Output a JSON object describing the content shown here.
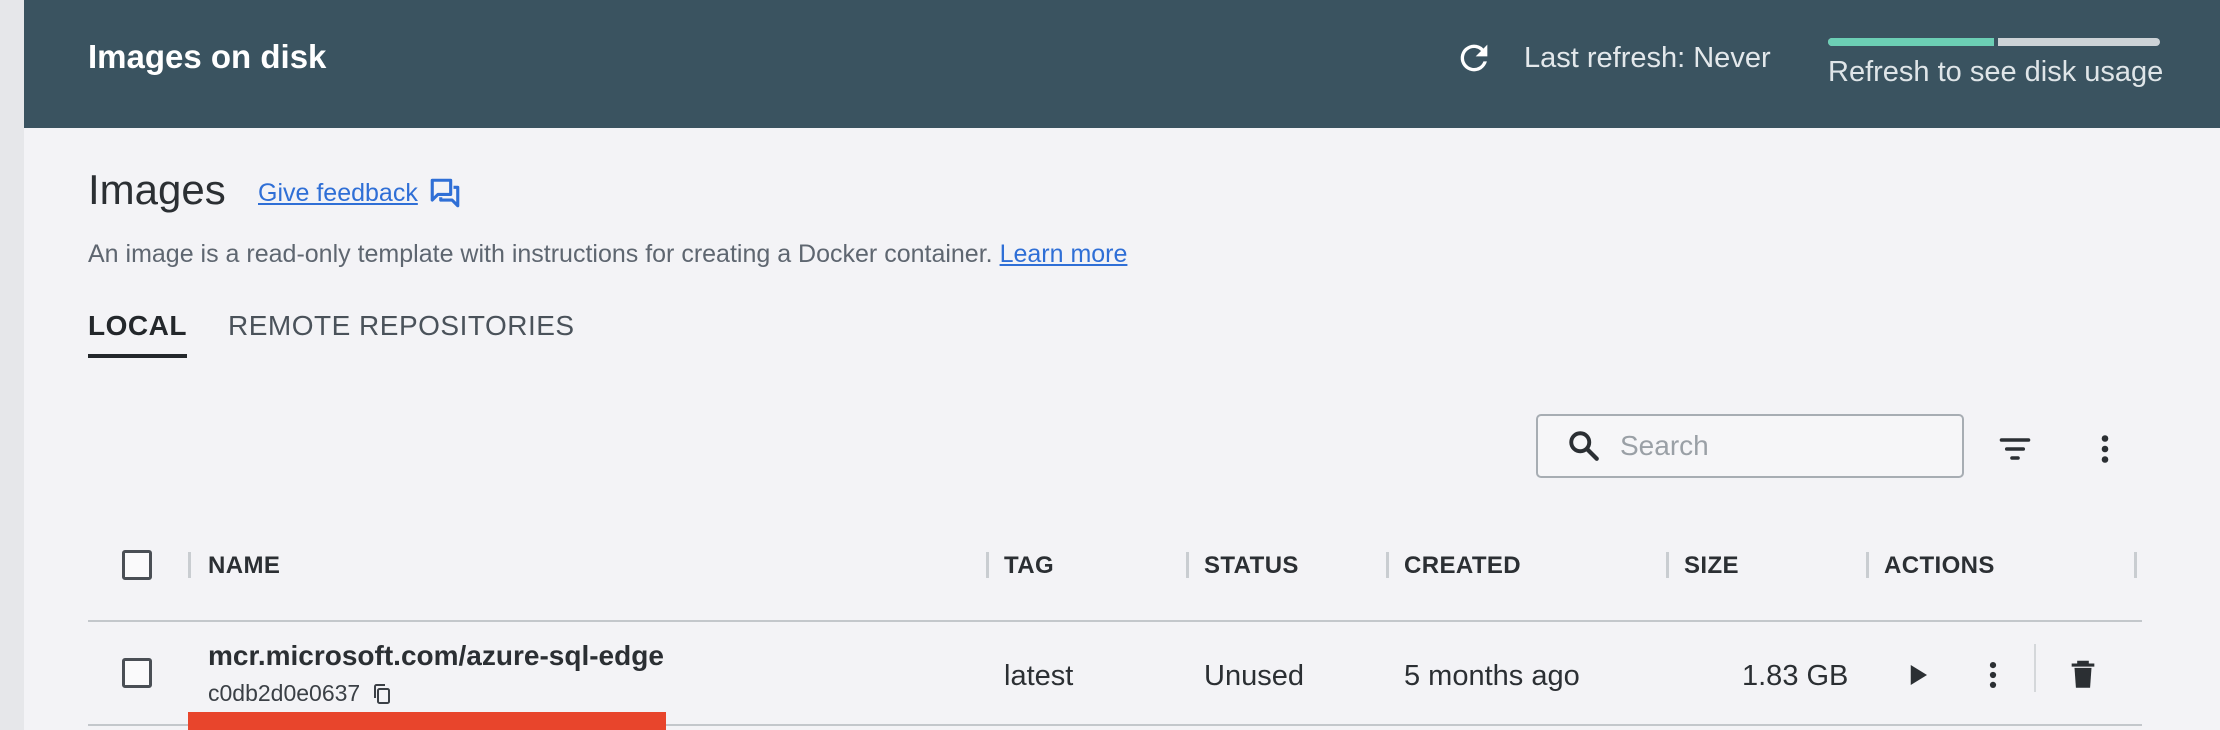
{
  "header": {
    "title": "Images on disk",
    "last_refresh": "Last refresh: Never",
    "disk_usage_label": "Refresh to see disk usage",
    "disk_bar_fill_fraction": 0.5,
    "refresh_icon": "refresh-icon"
  },
  "page": {
    "heading": "Images",
    "feedback_link": "Give feedback",
    "feedback_icon": "feedback-chat-icon",
    "description": "An image is a read-only template with instructions for creating a Docker container.",
    "learn_more": "Learn more"
  },
  "tabs": [
    {
      "label": "LOCAL",
      "active": true
    },
    {
      "label": "REMOTE REPOSITORIES",
      "active": false
    }
  ],
  "toolbar": {
    "search_placeholder": "Search",
    "search_value": "",
    "filter_icon": "filter-icon",
    "more_icon": "more-vertical-icon"
  },
  "table": {
    "columns": [
      "NAME",
      "TAG",
      "STATUS",
      "CREATED",
      "SIZE",
      "ACTIONS"
    ],
    "rows": [
      {
        "name": "mcr.microsoft.com/azure-sql-edge",
        "id": "c0db2d0e0637",
        "tag": "latest",
        "status": "Unused",
        "created": "5 months ago",
        "size": "1.83 GB",
        "actions": [
          "run-icon",
          "more-vertical-icon",
          "delete-icon"
        ]
      }
    ]
  },
  "colors": {
    "header_bg": "#3a5360",
    "accent_green": "#6ccfb5",
    "link_blue": "#2f6fd6",
    "annotation_red": "#e8452c"
  }
}
